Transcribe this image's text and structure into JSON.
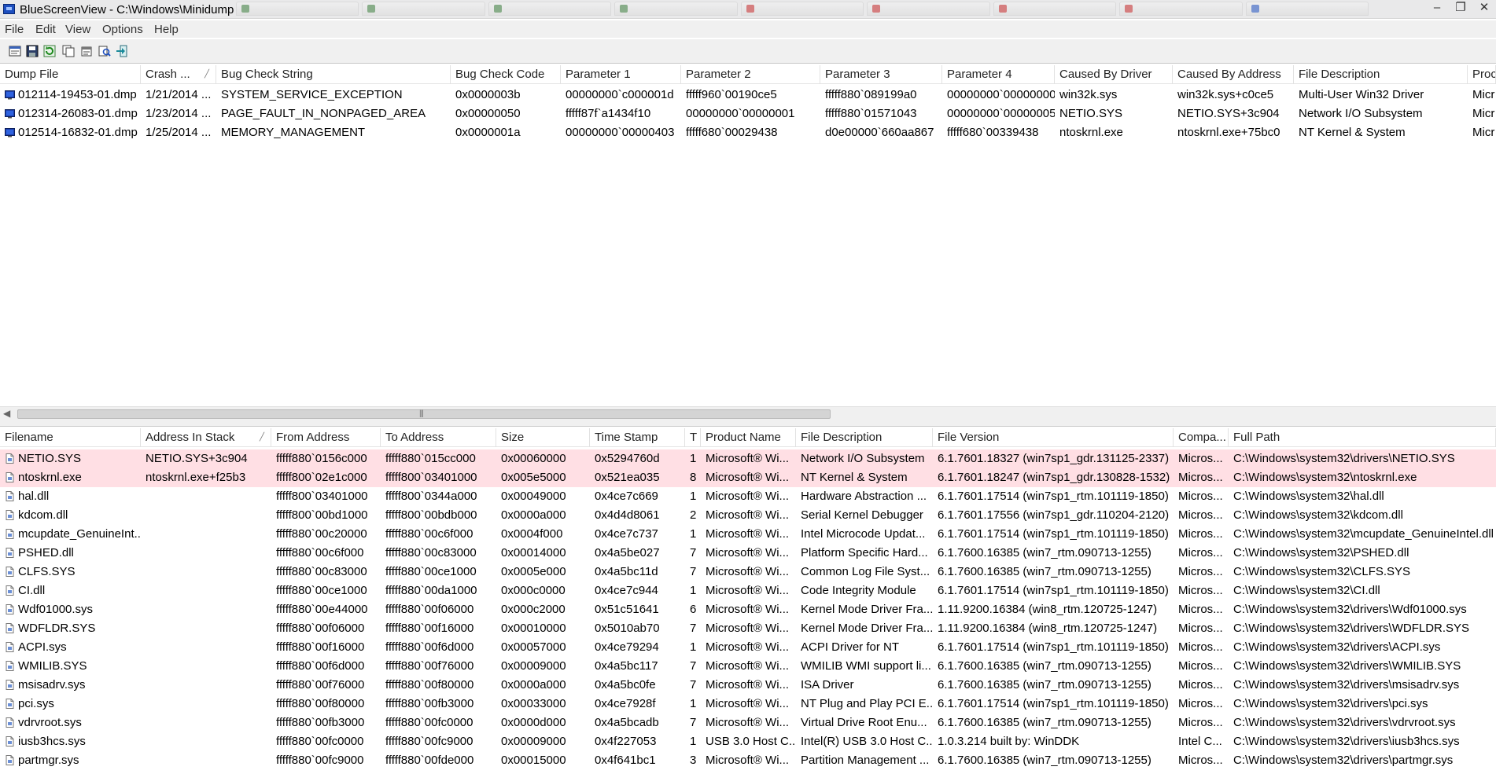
{
  "window": {
    "title": "BlueScreenView  -  C:\\Windows\\Minidump",
    "minimize": "‒",
    "maximize": "❐",
    "close": "✕"
  },
  "background_tab_colors": [
    "#3a7d3a",
    "#3a7d3a",
    "#3a7d3a",
    "#3a7d3a",
    "#c62828",
    "#c62828",
    "#c62828",
    "#c62828",
    "#1e4fbf"
  ],
  "menu": [
    "File",
    "Edit",
    "View",
    "Options",
    "Help"
  ],
  "toolbar": [
    {
      "name": "html-report-button",
      "icon": "report-icon"
    },
    {
      "name": "save-button",
      "icon": "floppy-icon"
    },
    {
      "name": "refresh-button",
      "icon": "refresh-icon"
    },
    {
      "name": "copy-button",
      "icon": "copy-icon"
    },
    {
      "name": "properties-button",
      "icon": "properties-icon"
    },
    {
      "name": "find-button",
      "icon": "find-icon"
    },
    {
      "name": "exit-button",
      "icon": "exit-icon"
    }
  ],
  "dumps": {
    "columns": [
      "Dump File",
      "Crash ...",
      "Bug Check String",
      "Bug Check Code",
      "Parameter 1",
      "Parameter 2",
      "Parameter 3",
      "Parameter 4",
      "Caused By Driver",
      "Caused By Address",
      "File Description",
      "Proc"
    ],
    "sorted_column": "Crash ...",
    "rows": [
      [
        "012114-19453-01.dmp",
        "1/21/2014 ...",
        "SYSTEM_SERVICE_EXCEPTION",
        "0x0000003b",
        "00000000`c000001d",
        "fffff960`00190ce5",
        "fffff880`089199a0",
        "00000000`00000000",
        "win32k.sys",
        "win32k.sys+c0ce5",
        "Multi-User Win32 Driver",
        "Micr"
      ],
      [
        "012314-26083-01.dmp",
        "1/23/2014 ...",
        "PAGE_FAULT_IN_NONPAGED_AREA",
        "0x00000050",
        "fffff87f`a1434f10",
        "00000000`00000001",
        "fffff880`01571043",
        "00000000`00000005",
        "NETIO.SYS",
        "NETIO.SYS+3c904",
        "Network I/O Subsystem",
        "Micr"
      ],
      [
        "012514-16832-01.dmp",
        "1/25/2014 ...",
        "MEMORY_MANAGEMENT",
        "0x0000001a",
        "00000000`00000403",
        "fffff680`00029438",
        "d0e00000`660aa867",
        "fffff680`00339438",
        "ntoskrnl.exe",
        "ntoskrnl.exe+75bc0",
        "NT Kernel & System",
        "Micr"
      ]
    ],
    "selected_row": 1
  },
  "drivers": {
    "columns": [
      "Filename",
      "Address In Stack",
      "From Address",
      "To Address",
      "Size",
      "Time Stamp",
      "T",
      "Product Name",
      "File Description",
      "File Version",
      "Compa...",
      "Full Path"
    ],
    "sorted_column": "Address In Stack",
    "highlight_color": "#ffdfe4",
    "rows": [
      [
        "NETIO.SYS",
        "NETIO.SYS+3c904",
        "fffff880`0156c000",
        "fffff880`015cc000",
        "0x00060000",
        "0x5294760d",
        "1",
        "Microsoft® Wi...",
        "Network I/O Subsystem",
        "6.1.7601.18327 (win7sp1_gdr.131125-2337)",
        "Micros...",
        "C:\\Windows\\system32\\drivers\\NETIO.SYS"
      ],
      [
        "ntoskrnl.exe",
        "ntoskrnl.exe+f25b3",
        "fffff800`02e1c000",
        "fffff800`03401000",
        "0x005e5000",
        "0x521ea035",
        "8",
        "Microsoft® Wi...",
        "NT Kernel & System",
        "6.1.7601.18247 (win7sp1_gdr.130828-1532)",
        "Micros...",
        "C:\\Windows\\system32\\ntoskrnl.exe"
      ],
      [
        "hal.dll",
        "",
        "fffff800`03401000",
        "fffff800`0344a000",
        "0x00049000",
        "0x4ce7c669",
        "1",
        "Microsoft® Wi...",
        "Hardware Abstraction ...",
        "6.1.7601.17514 (win7sp1_rtm.101119-1850)",
        "Micros...",
        "C:\\Windows\\system32\\hal.dll"
      ],
      [
        "kdcom.dll",
        "",
        "fffff800`00bd1000",
        "fffff800`00bdb000",
        "0x0000a000",
        "0x4d4d8061",
        "2",
        "Microsoft® Wi...",
        "Serial Kernel Debugger",
        "6.1.7601.17556 (win7sp1_gdr.110204-2120)",
        "Micros...",
        "C:\\Windows\\system32\\kdcom.dll"
      ],
      [
        "mcupdate_GenuineInt...",
        "",
        "fffff880`00c20000",
        "fffff880`00c6f000",
        "0x0004f000",
        "0x4ce7c737",
        "1",
        "Microsoft® Wi...",
        "Intel Microcode Updat...",
        "6.1.7601.17514 (win7sp1_rtm.101119-1850)",
        "Micros...",
        "C:\\Windows\\system32\\mcupdate_GenuineIntel.dll"
      ],
      [
        "PSHED.dll",
        "",
        "fffff880`00c6f000",
        "fffff880`00c83000",
        "0x00014000",
        "0x4a5be027",
        "7",
        "Microsoft® Wi...",
        "Platform Specific Hard...",
        "6.1.7600.16385 (win7_rtm.090713-1255)",
        "Micros...",
        "C:\\Windows\\system32\\PSHED.dll"
      ],
      [
        "CLFS.SYS",
        "",
        "fffff880`00c83000",
        "fffff880`00ce1000",
        "0x0005e000",
        "0x4a5bc11d",
        "7",
        "Microsoft® Wi...",
        "Common Log File Syst...",
        "6.1.7600.16385 (win7_rtm.090713-1255)",
        "Micros...",
        "C:\\Windows\\system32\\CLFS.SYS"
      ],
      [
        "CI.dll",
        "",
        "fffff880`00ce1000",
        "fffff880`00da1000",
        "0x000c0000",
        "0x4ce7c944",
        "1",
        "Microsoft® Wi...",
        "Code Integrity Module",
        "6.1.7601.17514 (win7sp1_rtm.101119-1850)",
        "Micros...",
        "C:\\Windows\\system32\\CI.dll"
      ],
      [
        "Wdf01000.sys",
        "",
        "fffff880`00e44000",
        "fffff880`00f06000",
        "0x000c2000",
        "0x51c51641",
        "6",
        "Microsoft® Wi...",
        "Kernel Mode Driver Fra...",
        "1.11.9200.16384 (win8_rtm.120725-1247)",
        "Micros...",
        "C:\\Windows\\system32\\drivers\\Wdf01000.sys"
      ],
      [
        "WDFLDR.SYS",
        "",
        "fffff880`00f06000",
        "fffff880`00f16000",
        "0x00010000",
        "0x5010ab70",
        "7",
        "Microsoft® Wi...",
        "Kernel Mode Driver Fra...",
        "1.11.9200.16384 (win8_rtm.120725-1247)",
        "Micros...",
        "C:\\Windows\\system32\\drivers\\WDFLDR.SYS"
      ],
      [
        "ACPI.sys",
        "",
        "fffff880`00f16000",
        "fffff880`00f6d000",
        "0x00057000",
        "0x4ce79294",
        "1",
        "Microsoft® Wi...",
        "ACPI Driver for NT",
        "6.1.7601.17514 (win7sp1_rtm.101119-1850)",
        "Micros...",
        "C:\\Windows\\system32\\drivers\\ACPI.sys"
      ],
      [
        "WMILIB.SYS",
        "",
        "fffff880`00f6d000",
        "fffff880`00f76000",
        "0x00009000",
        "0x4a5bc117",
        "7",
        "Microsoft® Wi...",
        "WMILIB WMI support li...",
        "6.1.7600.16385 (win7_rtm.090713-1255)",
        "Micros...",
        "C:\\Windows\\system32\\drivers\\WMILIB.SYS"
      ],
      [
        "msisadrv.sys",
        "",
        "fffff880`00f76000",
        "fffff880`00f80000",
        "0x0000a000",
        "0x4a5bc0fe",
        "7",
        "Microsoft® Wi...",
        "ISA Driver",
        "6.1.7600.16385 (win7_rtm.090713-1255)",
        "Micros...",
        "C:\\Windows\\system32\\drivers\\msisadrv.sys"
      ],
      [
        "pci.sys",
        "",
        "fffff880`00f80000",
        "fffff880`00fb3000",
        "0x00033000",
        "0x4ce7928f",
        "1",
        "Microsoft® Wi...",
        "NT Plug and Play PCI E...",
        "6.1.7601.17514 (win7sp1_rtm.101119-1850)",
        "Micros...",
        "C:\\Windows\\system32\\drivers\\pci.sys"
      ],
      [
        "vdrvroot.sys",
        "",
        "fffff880`00fb3000",
        "fffff880`00fc0000",
        "0x0000d000",
        "0x4a5bcadb",
        "7",
        "Microsoft® Wi...",
        "Virtual Drive Root Enu...",
        "6.1.7600.16385 (win7_rtm.090713-1255)",
        "Micros...",
        "C:\\Windows\\system32\\drivers\\vdrvroot.sys"
      ],
      [
        "iusb3hcs.sys",
        "",
        "fffff880`00fc0000",
        "fffff880`00fc9000",
        "0x00009000",
        "0x4f227053",
        "1",
        "USB 3.0 Host C...",
        "Intel(R) USB 3.0 Host C...",
        "1.0.3.214 built by: WinDDK",
        "Intel C...",
        "C:\\Windows\\system32\\drivers\\iusb3hcs.sys"
      ],
      [
        "partmgr.sys",
        "",
        "fffff880`00fc9000",
        "fffff880`00fde000",
        "0x00015000",
        "0x4f641bc1",
        "3",
        "Microsoft® Wi...",
        "Partition Management ...",
        "6.1.7600.16385 (win7_rtm.090713-1255)",
        "Micros...",
        "C:\\Windows\\system32\\drivers\\partmgr.sys"
      ]
    ],
    "highlighted_rows": [
      0,
      1
    ]
  }
}
